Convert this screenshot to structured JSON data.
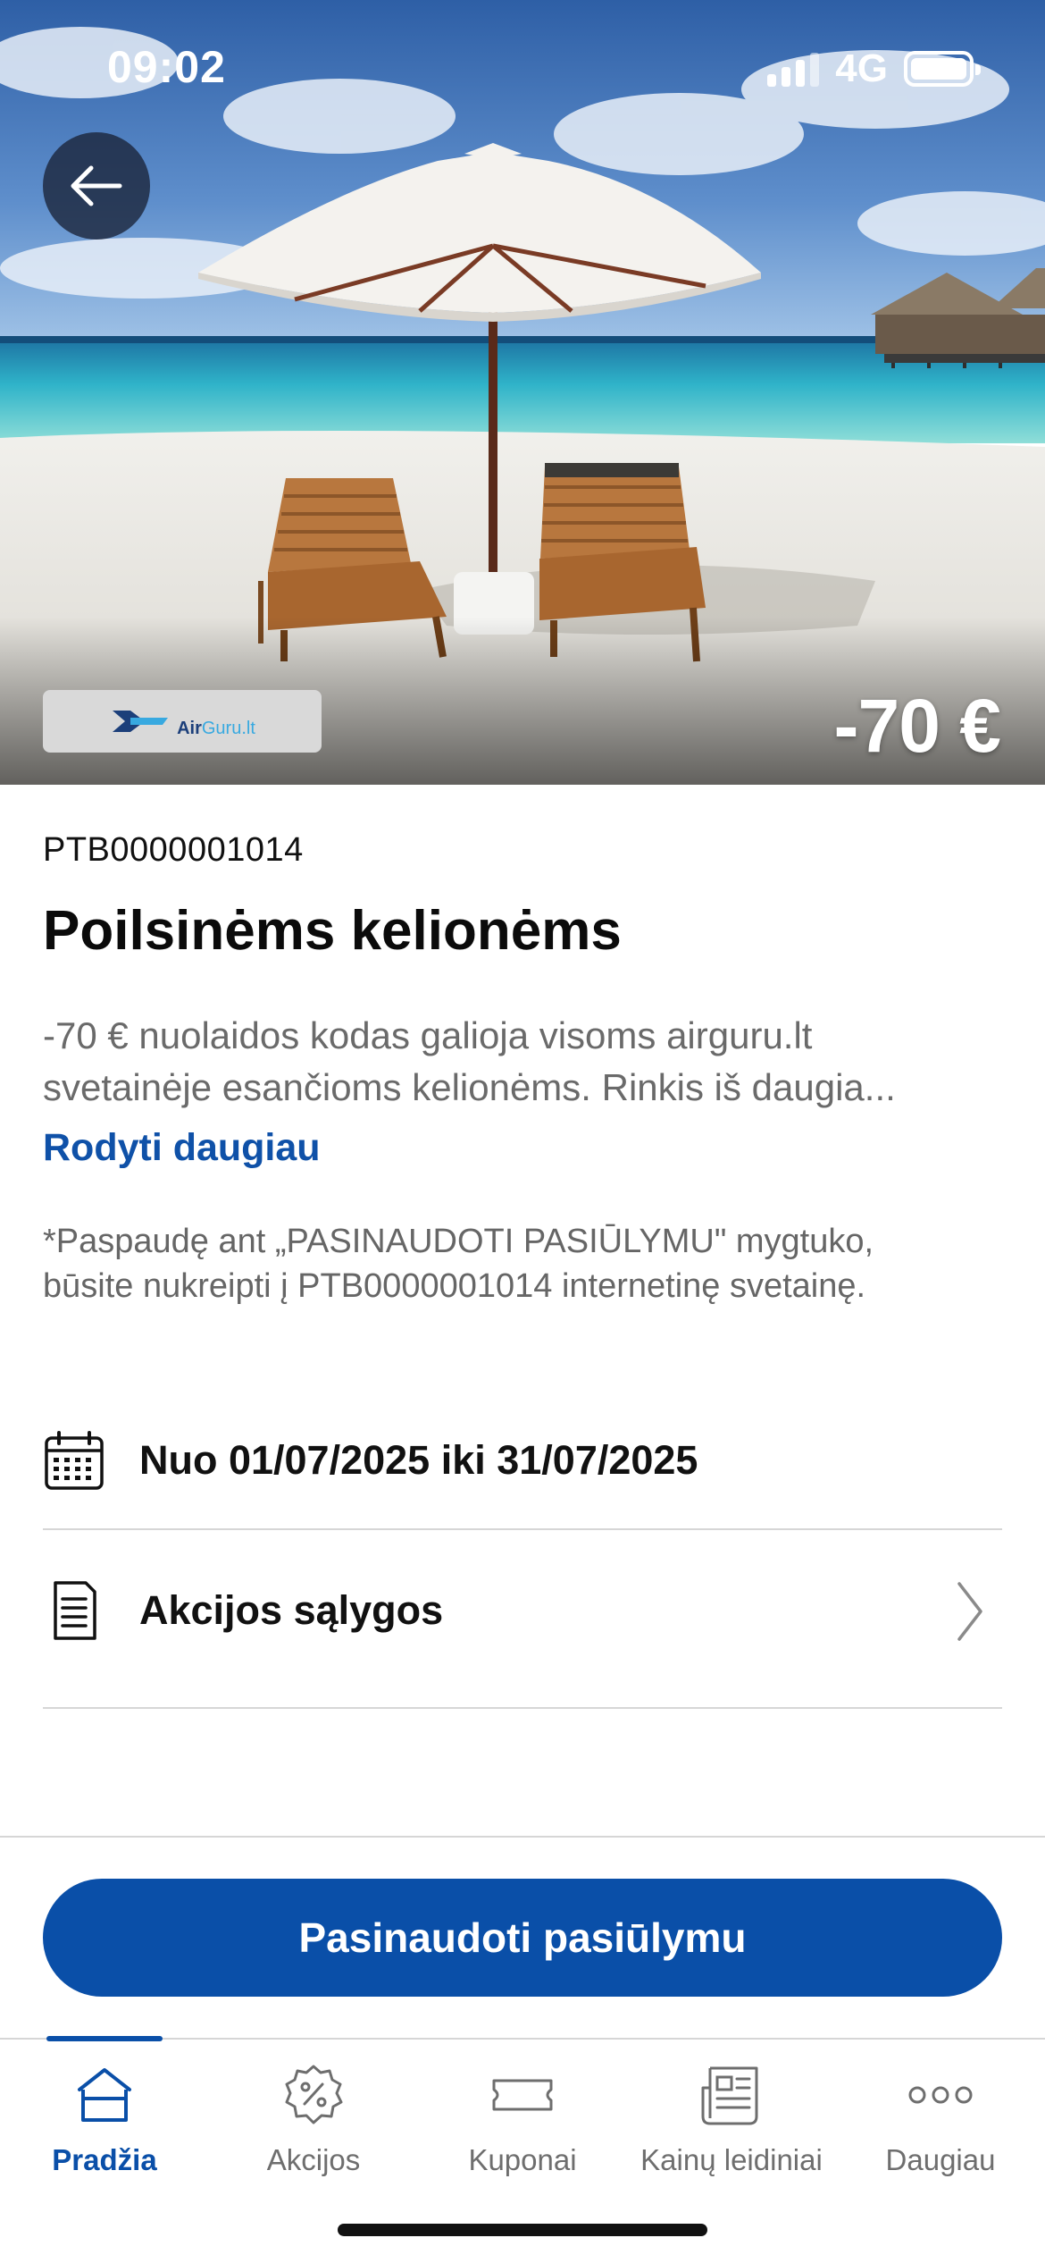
{
  "status_bar": {
    "time": "09:02",
    "network": "4G"
  },
  "hero": {
    "partner_logo": {
      "text_dark": "Air",
      "text_light": "Guru.lt"
    },
    "discount": "-70 €"
  },
  "offer": {
    "code": "PTB0000001014",
    "title": "Poilsinėms kelionėms",
    "description_line1": "-70 € nuolaidos kodas galioja visoms airguru.lt",
    "description_line2": "svetainėje esančioms kelionėms. Rinkis iš daugia...",
    "show_more": "Rodyti daugiau",
    "disclaimer_line1": "*Paspaudę ant „PASINAUDOTI PASIŪLYMU\" mygtuko,",
    "disclaimer_line2": "būsite nukreipti į PTB0000001014 internetinę svetainę.",
    "dates": "Nuo 01/07/2025 iki 31/07/2025",
    "terms": "Akcijos sąlygos"
  },
  "cta": {
    "label": "Pasinaudoti pasiūlymu"
  },
  "tabbar": {
    "items": [
      {
        "label": "Pradžia",
        "icon": "home-icon",
        "active": true
      },
      {
        "label": "Akcijos",
        "icon": "percent-badge-icon",
        "active": false
      },
      {
        "label": "Kuponai",
        "icon": "ticket-icon",
        "active": false
      },
      {
        "label": "Kainų leidiniai",
        "icon": "leaflet-icon",
        "active": false
      },
      {
        "label": "Daugiau",
        "icon": "more-dots-icon",
        "active": false
      }
    ]
  },
  "colors": {
    "brand_blue": "#0a4fa8",
    "link_blue": "#0f51a8",
    "muted_text": "#6a6a6a",
    "divider": "#d6d6d6"
  }
}
